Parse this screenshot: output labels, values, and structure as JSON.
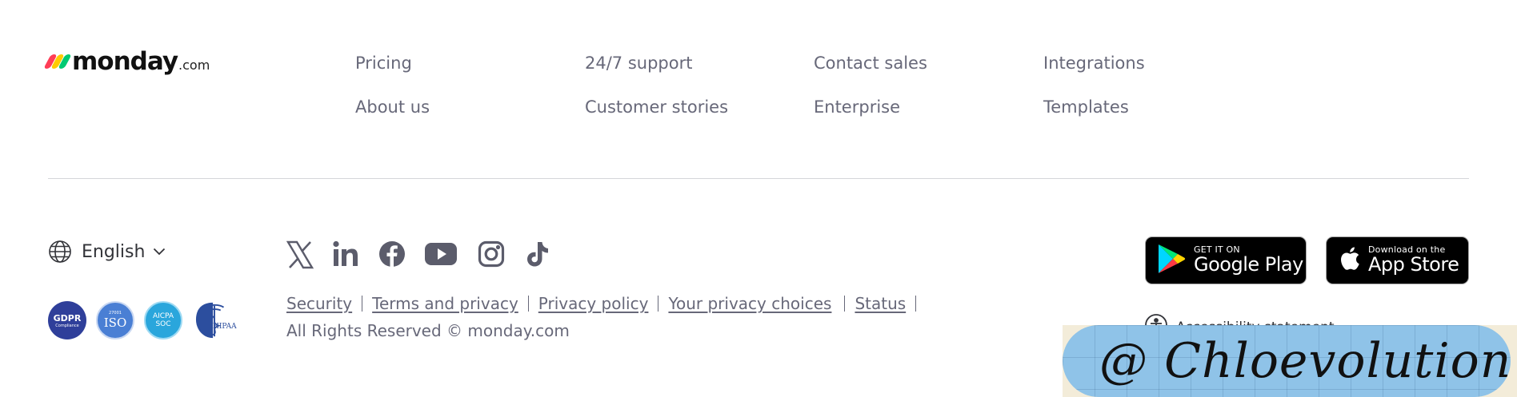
{
  "logo": {
    "word": "monday",
    "suffix": ".com",
    "colors": [
      "#ff3d57",
      "#ffcb00",
      "#00ca72"
    ]
  },
  "nav": {
    "col1": [
      "Pricing",
      "About us"
    ],
    "col2": [
      "24/7 support",
      "Customer stories"
    ],
    "col3": [
      "Contact sales",
      "Enterprise"
    ],
    "col4": [
      "Integrations",
      "Templates"
    ]
  },
  "language": {
    "label": "English",
    "icon": "globe-icon",
    "chevron": "chevron-down-icon"
  },
  "certifications": [
    {
      "name": "GDPR",
      "sub": "Compliance",
      "color": "#2f3f9a"
    },
    {
      "name": "ISO",
      "sub": "27001",
      "color": "#4a7fd4"
    },
    {
      "name": "AICPA",
      "sub": "SOC",
      "color": "#2aa6dc"
    },
    {
      "name": "HIPAA",
      "sub": "",
      "color": "#2c4e9e"
    }
  ],
  "social_icons": [
    "x-icon",
    "linkedin-icon",
    "facebook-icon",
    "youtube-icon",
    "instagram-icon",
    "tiktok-icon"
  ],
  "legal_links": [
    "Security",
    "Terms and privacy",
    "Privacy policy",
    "Your privacy choices",
    "Status"
  ],
  "copyright": "All Rights Reserved © monday.com",
  "stores": {
    "google": {
      "small": "GET IT ON",
      "big": "Google Play"
    },
    "apple": {
      "small": "Download on the",
      "big": "App Store"
    }
  },
  "accessibility": {
    "label": "Accessibility statement",
    "icon": "accessibility-icon"
  },
  "watermark": {
    "text": "@ Chloevolution"
  },
  "colors": {
    "text": "#323338",
    "muted": "#676879",
    "divider": "#d5d6da"
  }
}
